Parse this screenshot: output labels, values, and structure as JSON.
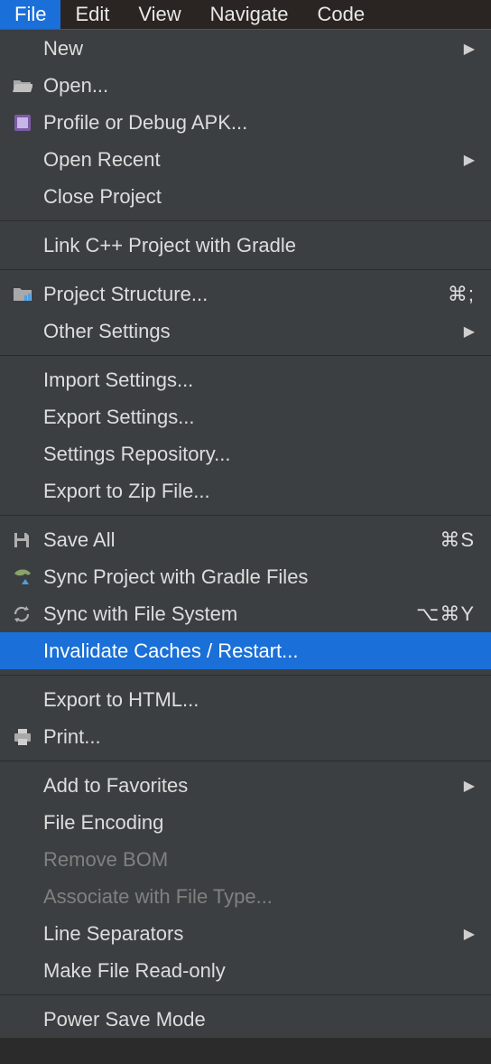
{
  "menubar": {
    "file": "File",
    "edit": "Edit",
    "view": "View",
    "navigate": "Navigate",
    "code": "Code"
  },
  "menu": {
    "new": "New",
    "open": "Open...",
    "profile_apk": "Profile or Debug APK...",
    "open_recent": "Open Recent",
    "close_project": "Close Project",
    "link_cpp": "Link C++ Project with Gradle",
    "project_structure": "Project Structure...",
    "project_structure_sc": "⌘;",
    "other_settings": "Other Settings",
    "import_settings": "Import Settings...",
    "export_settings": "Export Settings...",
    "settings_repo": "Settings Repository...",
    "export_zip": "Export to Zip File...",
    "save_all": "Save All",
    "save_all_sc": "⌘S",
    "sync_gradle": "Sync Project with Gradle Files",
    "sync_fs": "Sync with File System",
    "sync_fs_sc": "⌥⌘Y",
    "invalidate": "Invalidate Caches / Restart...",
    "export_html": "Export to HTML...",
    "print": "Print...",
    "add_favorites": "Add to Favorites",
    "file_encoding": "File Encoding",
    "remove_bom": "Remove BOM",
    "associate_type": "Associate with File Type...",
    "line_separators": "Line Separators",
    "make_readonly": "Make File Read-only",
    "power_save": "Power Save Mode"
  }
}
